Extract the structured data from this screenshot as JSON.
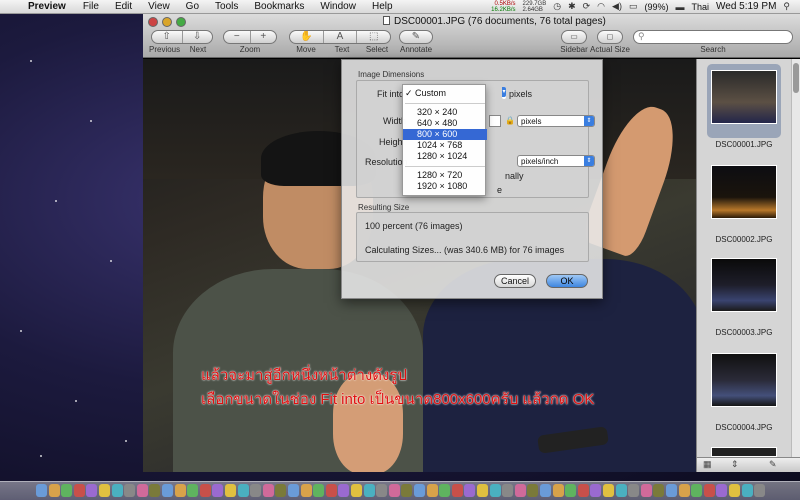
{
  "menubar": {
    "app_name": "Preview",
    "menus": [
      "File",
      "Edit",
      "View",
      "Go",
      "Tools",
      "Bookmarks",
      "Window",
      "Help"
    ],
    "net_up": "0.5KB/s",
    "net_down": "16.2KB/s",
    "disk_a": "229.7GB",
    "disk_b": "2.64GB",
    "battery": "(99%)",
    "input_source": "Thai",
    "clock": "Wed 5:19 PM"
  },
  "window": {
    "title": "DSC00001.JPG (76 documents, 76 total pages)",
    "toolbar_labels": {
      "previous": "Previous",
      "next": "Next",
      "zoom": "Zoom",
      "move": "Move",
      "text": "Text",
      "select": "Select",
      "annotate": "Annotate",
      "sidebar": "Sidebar",
      "actual_size": "Actual Size",
      "search": "Search"
    }
  },
  "overlay_text": {
    "line1": "แล้วจะมาสู่อีกหนึ่งหน้าต่างดังรูป",
    "line2": "เลือกขนาดในช่อง Fit into เป็นขนาด800x600ครับ แล้วกด OK"
  },
  "dialog": {
    "section_image": "Image Dimensions",
    "fit_into_label": "Fit into",
    "fit_unit": "pixels",
    "width_label": "Width",
    "height_label": "Heigh",
    "resolution_label": "Resolution",
    "width_unit": "pixels",
    "resolution_unit": "pixels/inch",
    "partial_text_1": "nally",
    "partial_text_2": "e",
    "section_result": "Resulting Size",
    "result_percent": "100 percent (76 images)",
    "result_calc": "Calculating Sizes... (was 340.6 MB) for 76 images",
    "cancel": "Cancel",
    "ok": "OK"
  },
  "size_menu": {
    "items": [
      "Custom",
      "320 × 240",
      "640 × 480",
      "800 × 600",
      "1024 × 768",
      "1280 × 1024",
      "1280 × 720",
      "1920 × 1080"
    ],
    "checked": "Custom",
    "highlighted": "800 × 600"
  },
  "thumbnails": [
    {
      "label": "DSC00001.JPG"
    },
    {
      "label": "DSC00002.JPG"
    },
    {
      "label": "DSC00003.JPG"
    },
    {
      "label": "DSC00004.JPG"
    }
  ]
}
